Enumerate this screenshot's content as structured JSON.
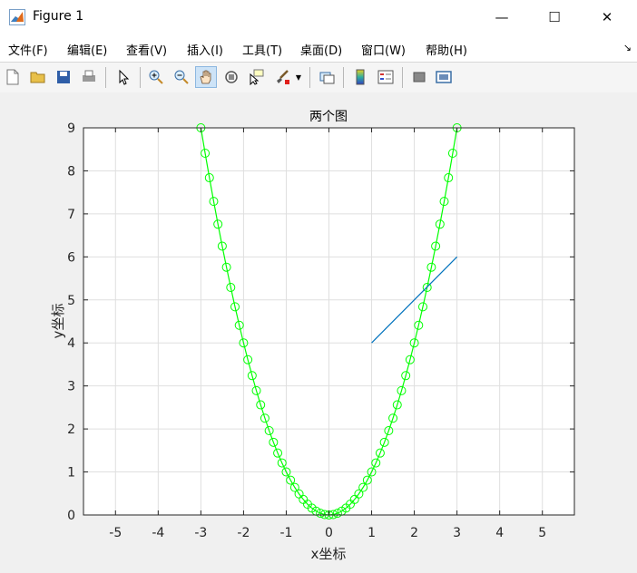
{
  "window": {
    "title": "Figure 1",
    "minimize_glyph": "—",
    "maximize_glyph": "☐",
    "close_glyph": "✕"
  },
  "menu": {
    "items": [
      "文件(F)",
      "编辑(E)",
      "查看(V)",
      "插入(I)",
      "工具(T)",
      "桌面(D)",
      "窗口(W)",
      "帮助(H)"
    ]
  },
  "toolbar": {
    "icons": [
      "new-figure-icon",
      "open-file-icon",
      "save-icon",
      "print-icon",
      "edit-plot-icon",
      "zoom-in-icon",
      "zoom-out-icon",
      "pan-icon",
      "rotate-3d-icon",
      "data-cursor-icon",
      "brush-icon",
      "link-plot-icon",
      "colorbar-icon",
      "legend-icon",
      "hide-plot-tools-icon",
      "show-plot-tools-icon"
    ],
    "active": "pan-icon"
  },
  "chart_data": {
    "type": "line",
    "title": "两个图",
    "xlabel": "x坐标",
    "ylabel": "y坐标",
    "xlim": [
      -5.75,
      5.75
    ],
    "ylim": [
      0,
      9
    ],
    "xticks": [
      -5,
      -4,
      -3,
      -2,
      -1,
      0,
      1,
      2,
      3,
      4,
      5
    ],
    "yticks": [
      0,
      1,
      2,
      3,
      4,
      5,
      6,
      7,
      8,
      9
    ],
    "grid": true,
    "series": [
      {
        "kind": "parabola",
        "color": "#00ff00",
        "marker": "circle",
        "x": [
          -3.0,
          -2.9,
          -2.8,
          -2.7,
          -2.6,
          -2.5,
          -2.4,
          -2.3,
          -2.2,
          -2.1,
          -2.0,
          -1.9,
          -1.8,
          -1.7,
          -1.6,
          -1.5,
          -1.4,
          -1.3,
          -1.2,
          -1.1,
          -1.0,
          -0.9,
          -0.8,
          -0.7,
          -0.6,
          -0.5,
          -0.4,
          -0.3,
          -0.2,
          -0.1,
          0.0,
          0.1,
          0.2,
          0.3,
          0.4,
          0.5,
          0.6,
          0.7,
          0.8,
          0.9,
          1.0,
          1.1,
          1.2,
          1.3,
          1.4,
          1.5,
          1.6,
          1.7,
          1.8,
          1.9,
          2.0,
          2.1,
          2.2,
          2.3,
          2.4,
          2.5,
          2.6,
          2.7,
          2.8,
          2.9,
          3.0
        ],
        "y": [
          9.0,
          8.41,
          7.84,
          7.29,
          6.76,
          6.25,
          5.76,
          5.29,
          4.84,
          4.41,
          4.0,
          3.61,
          3.24,
          2.89,
          2.56,
          2.25,
          1.96,
          1.69,
          1.44,
          1.21,
          1.0,
          0.81,
          0.64,
          0.49,
          0.36,
          0.25,
          0.16,
          0.09,
          0.04,
          0.01,
          0.0,
          0.01,
          0.04,
          0.09,
          0.16,
          0.25,
          0.36,
          0.49,
          0.64,
          0.81,
          1.0,
          1.21,
          1.44,
          1.69,
          1.96,
          2.25,
          2.56,
          2.89,
          3.24,
          3.61,
          4.0,
          4.41,
          4.84,
          5.29,
          5.76,
          6.25,
          6.76,
          7.29,
          7.84,
          8.41,
          9.0
        ]
      },
      {
        "kind": "line",
        "color": "#0072bd",
        "marker": "none",
        "x": [
          1,
          3
        ],
        "y": [
          4,
          6
        ]
      }
    ]
  }
}
